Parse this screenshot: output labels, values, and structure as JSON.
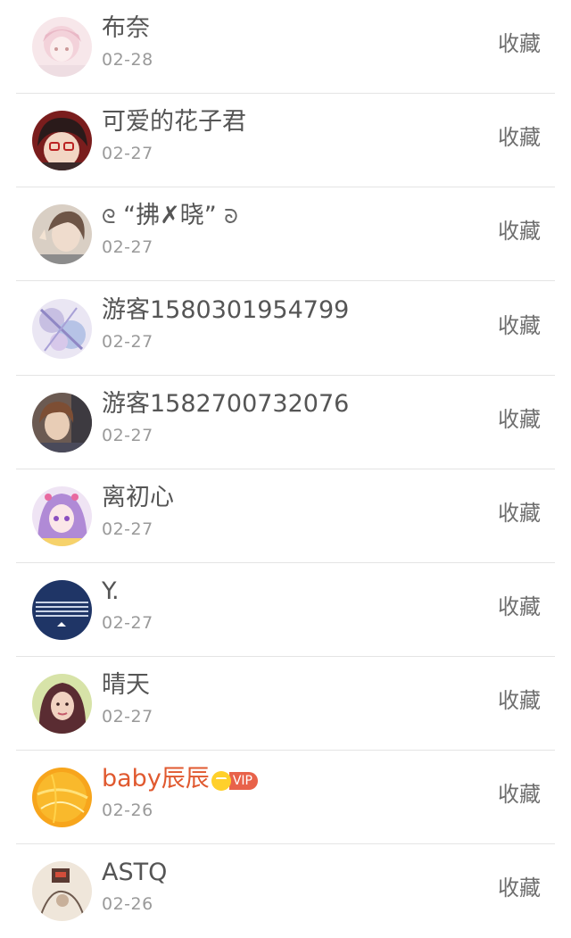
{
  "contacts": [
    {
      "name": "布奈",
      "date": "02-28",
      "action": "收藏",
      "avatar": "avatar-anime-pink"
    },
    {
      "name": "可爱的花子君",
      "date": "02-27",
      "action": "收藏",
      "avatar": "avatar-anime-boy"
    },
    {
      "name": "“拂✗晓”",
      "name_prefix": "ᘓ",
      "name_suffix": "ᘐ",
      "date": "02-27",
      "action": "收藏",
      "avatar": "avatar-girl-photo"
    },
    {
      "name": "游客1580301954799",
      "date": "02-27",
      "action": "收藏",
      "avatar": "avatar-anime-purple"
    },
    {
      "name": "游客1582700732076",
      "date": "02-27",
      "action": "收藏",
      "avatar": "avatar-anime-brown"
    },
    {
      "name": "离初心",
      "date": "02-27",
      "action": "收藏",
      "avatar": "avatar-anime-lilac"
    },
    {
      "name": "Y.",
      "date": "02-27",
      "action": "收藏",
      "avatar": "avatar-navy-stripes"
    },
    {
      "name": "晴天",
      "date": "02-27",
      "action": "收藏",
      "avatar": "avatar-woman-photo"
    },
    {
      "name": "baby辰辰",
      "date": "02-26",
      "action": "收藏",
      "avatar": "avatar-orange-ball",
      "vip": true,
      "vip_label": "VIP"
    },
    {
      "name": "ASTQ",
      "date": "02-26",
      "action": "收藏",
      "avatar": "avatar-sketch"
    }
  ],
  "colors": {
    "name": "#555555",
    "vip_name": "#e0592f",
    "date": "#9a9a9a",
    "action": "#6f6f6f",
    "divider": "#e4e4e4"
  }
}
